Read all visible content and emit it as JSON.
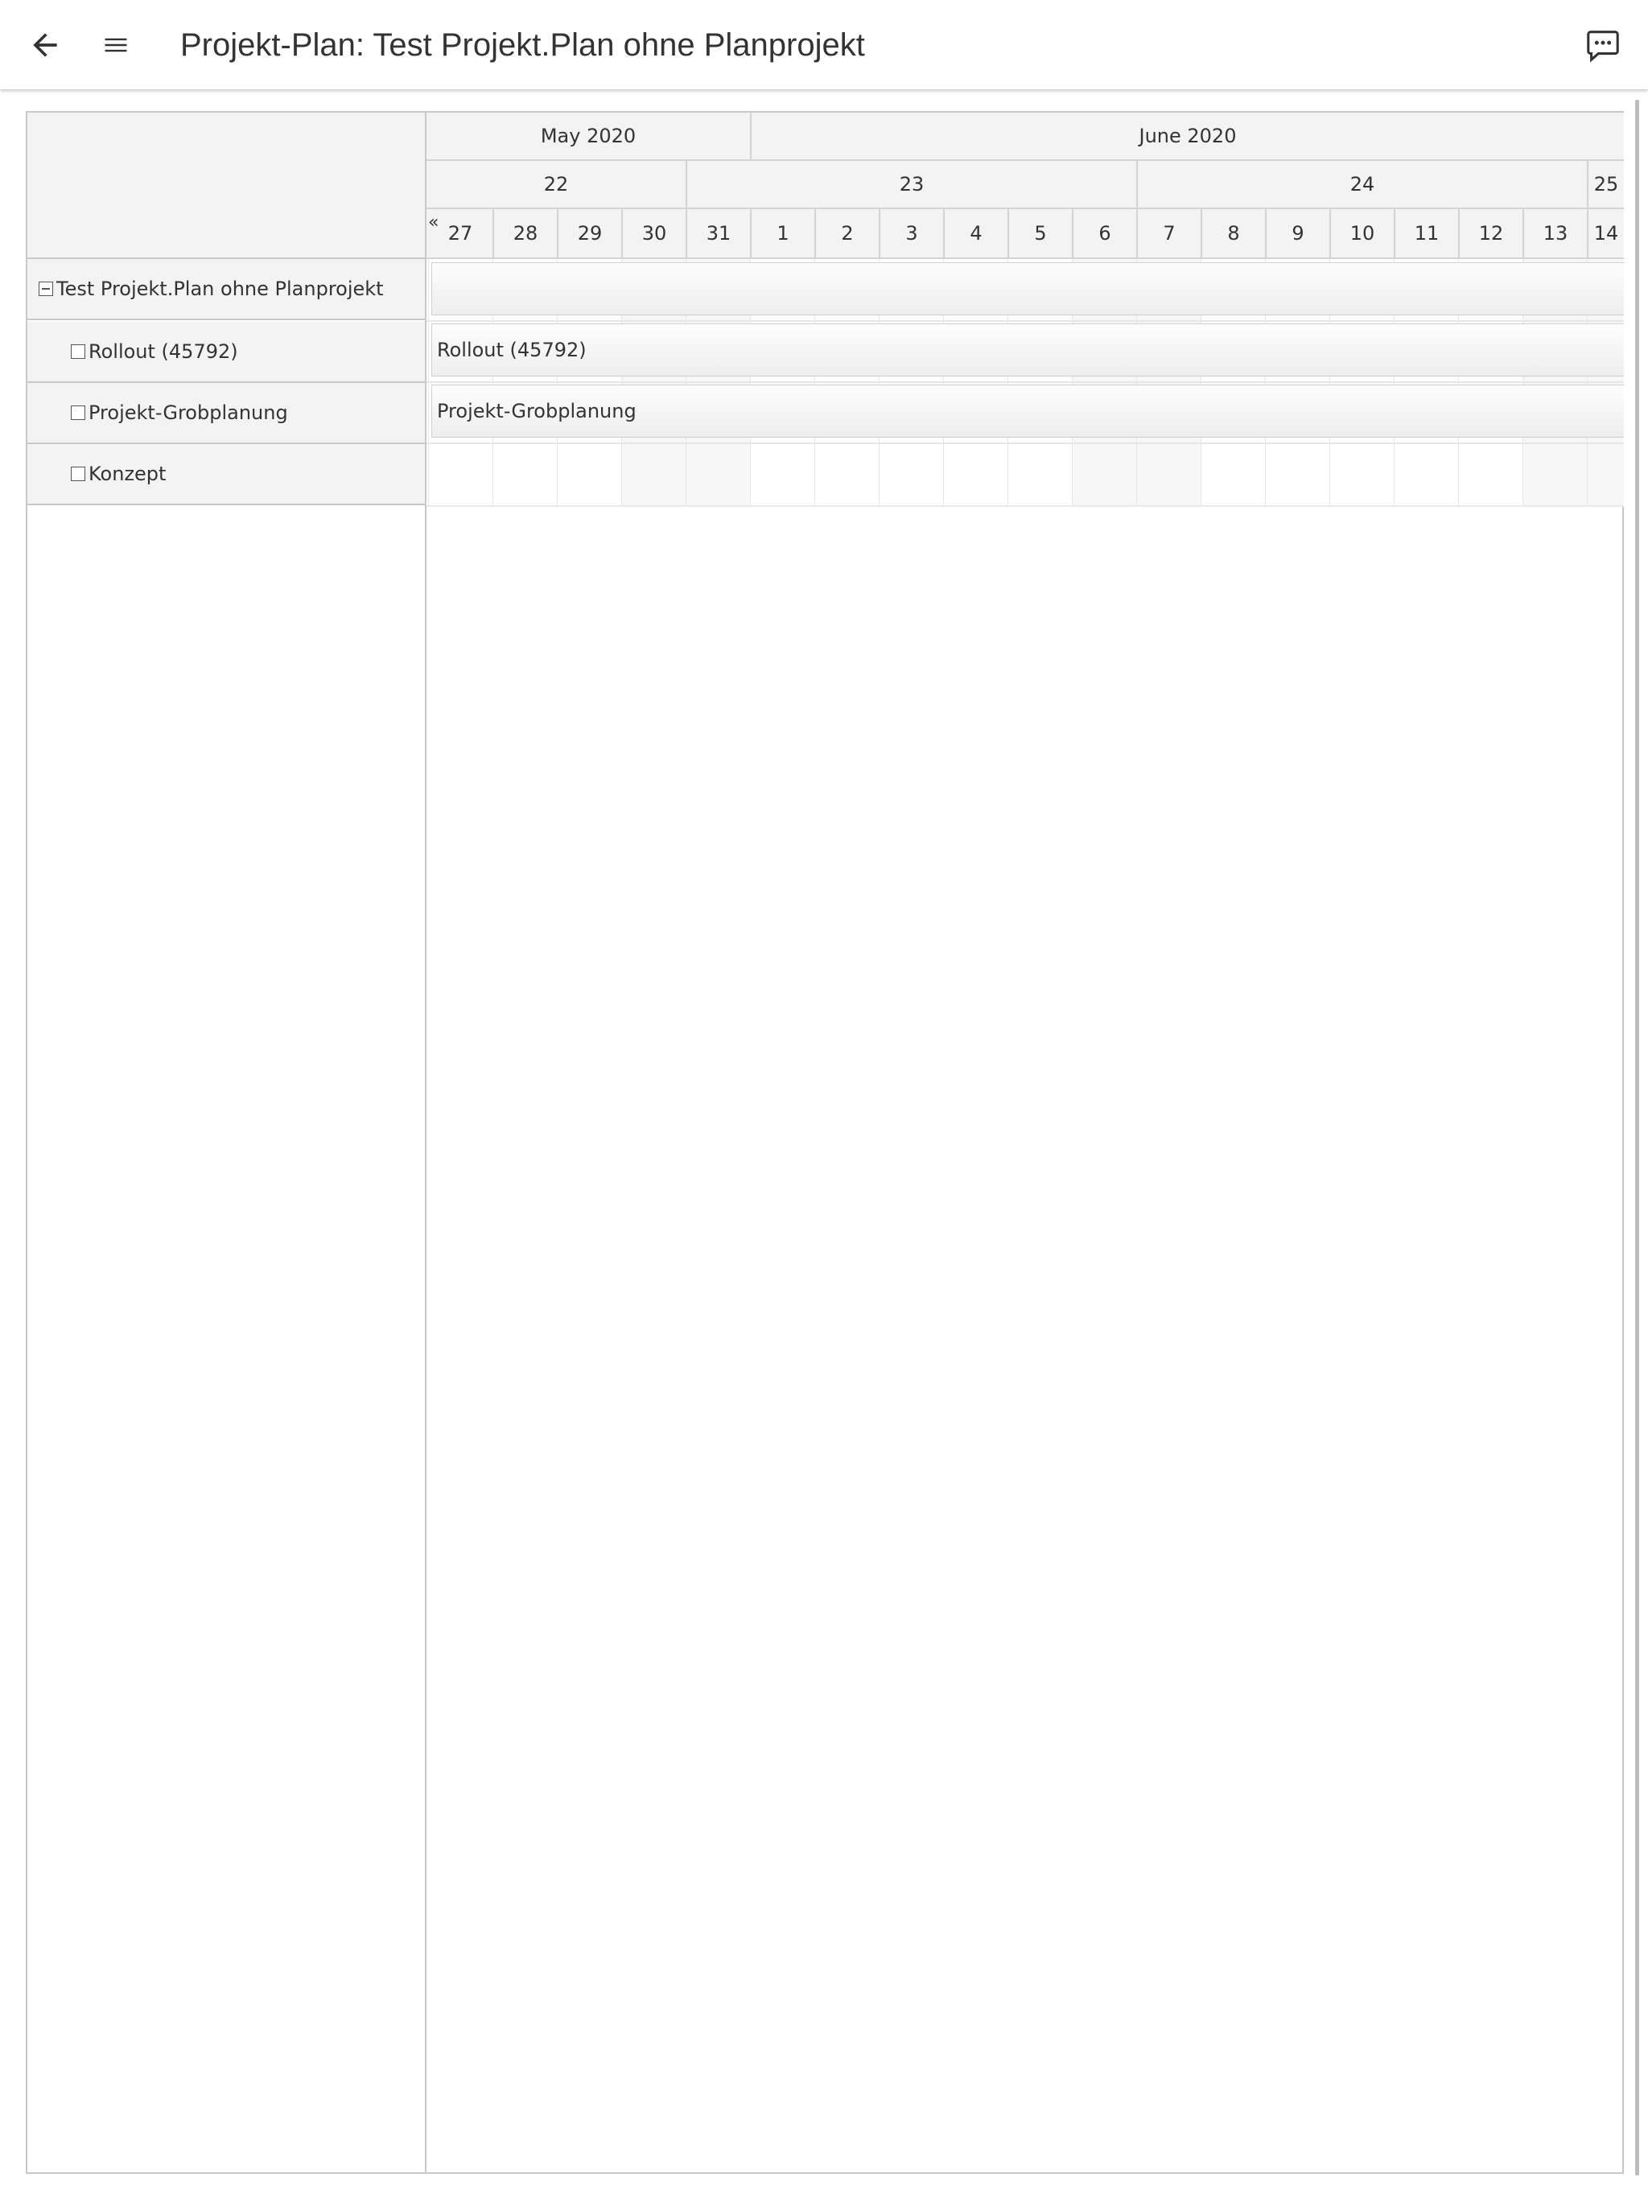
{
  "header": {
    "title": "Projekt-Plan: Test Projekt.Plan ohne Planprojekt",
    "back_icon": "arrow-left-icon",
    "menu_icon": "hamburger-menu-icon",
    "chat_icon": "comment-dots-icon"
  },
  "timeline": {
    "scroll_back": "«",
    "months": [
      "May 2020",
      "June 2020"
    ],
    "weeks": [
      "22",
      "23",
      "24",
      "25"
    ],
    "days": [
      "27",
      "28",
      "29",
      "30",
      "31",
      "1",
      "2",
      "3",
      "4",
      "5",
      "6",
      "7",
      "8",
      "9",
      "10",
      "11",
      "12",
      "13",
      "14"
    ]
  },
  "tasks": [
    {
      "label": "Test Projekt.Plan ohne Planprojekt",
      "bar_label": "",
      "expanded": true,
      "has_bar": true
    },
    {
      "label": "Rollout (45792)",
      "bar_label": "Rollout (45792)",
      "has_bar": true
    },
    {
      "label": "Projekt-Grobplanung",
      "bar_label": "Projekt-Grobplanung",
      "has_bar": true
    },
    {
      "label": "Konzept",
      "bar_label": "",
      "has_bar": false
    }
  ]
}
